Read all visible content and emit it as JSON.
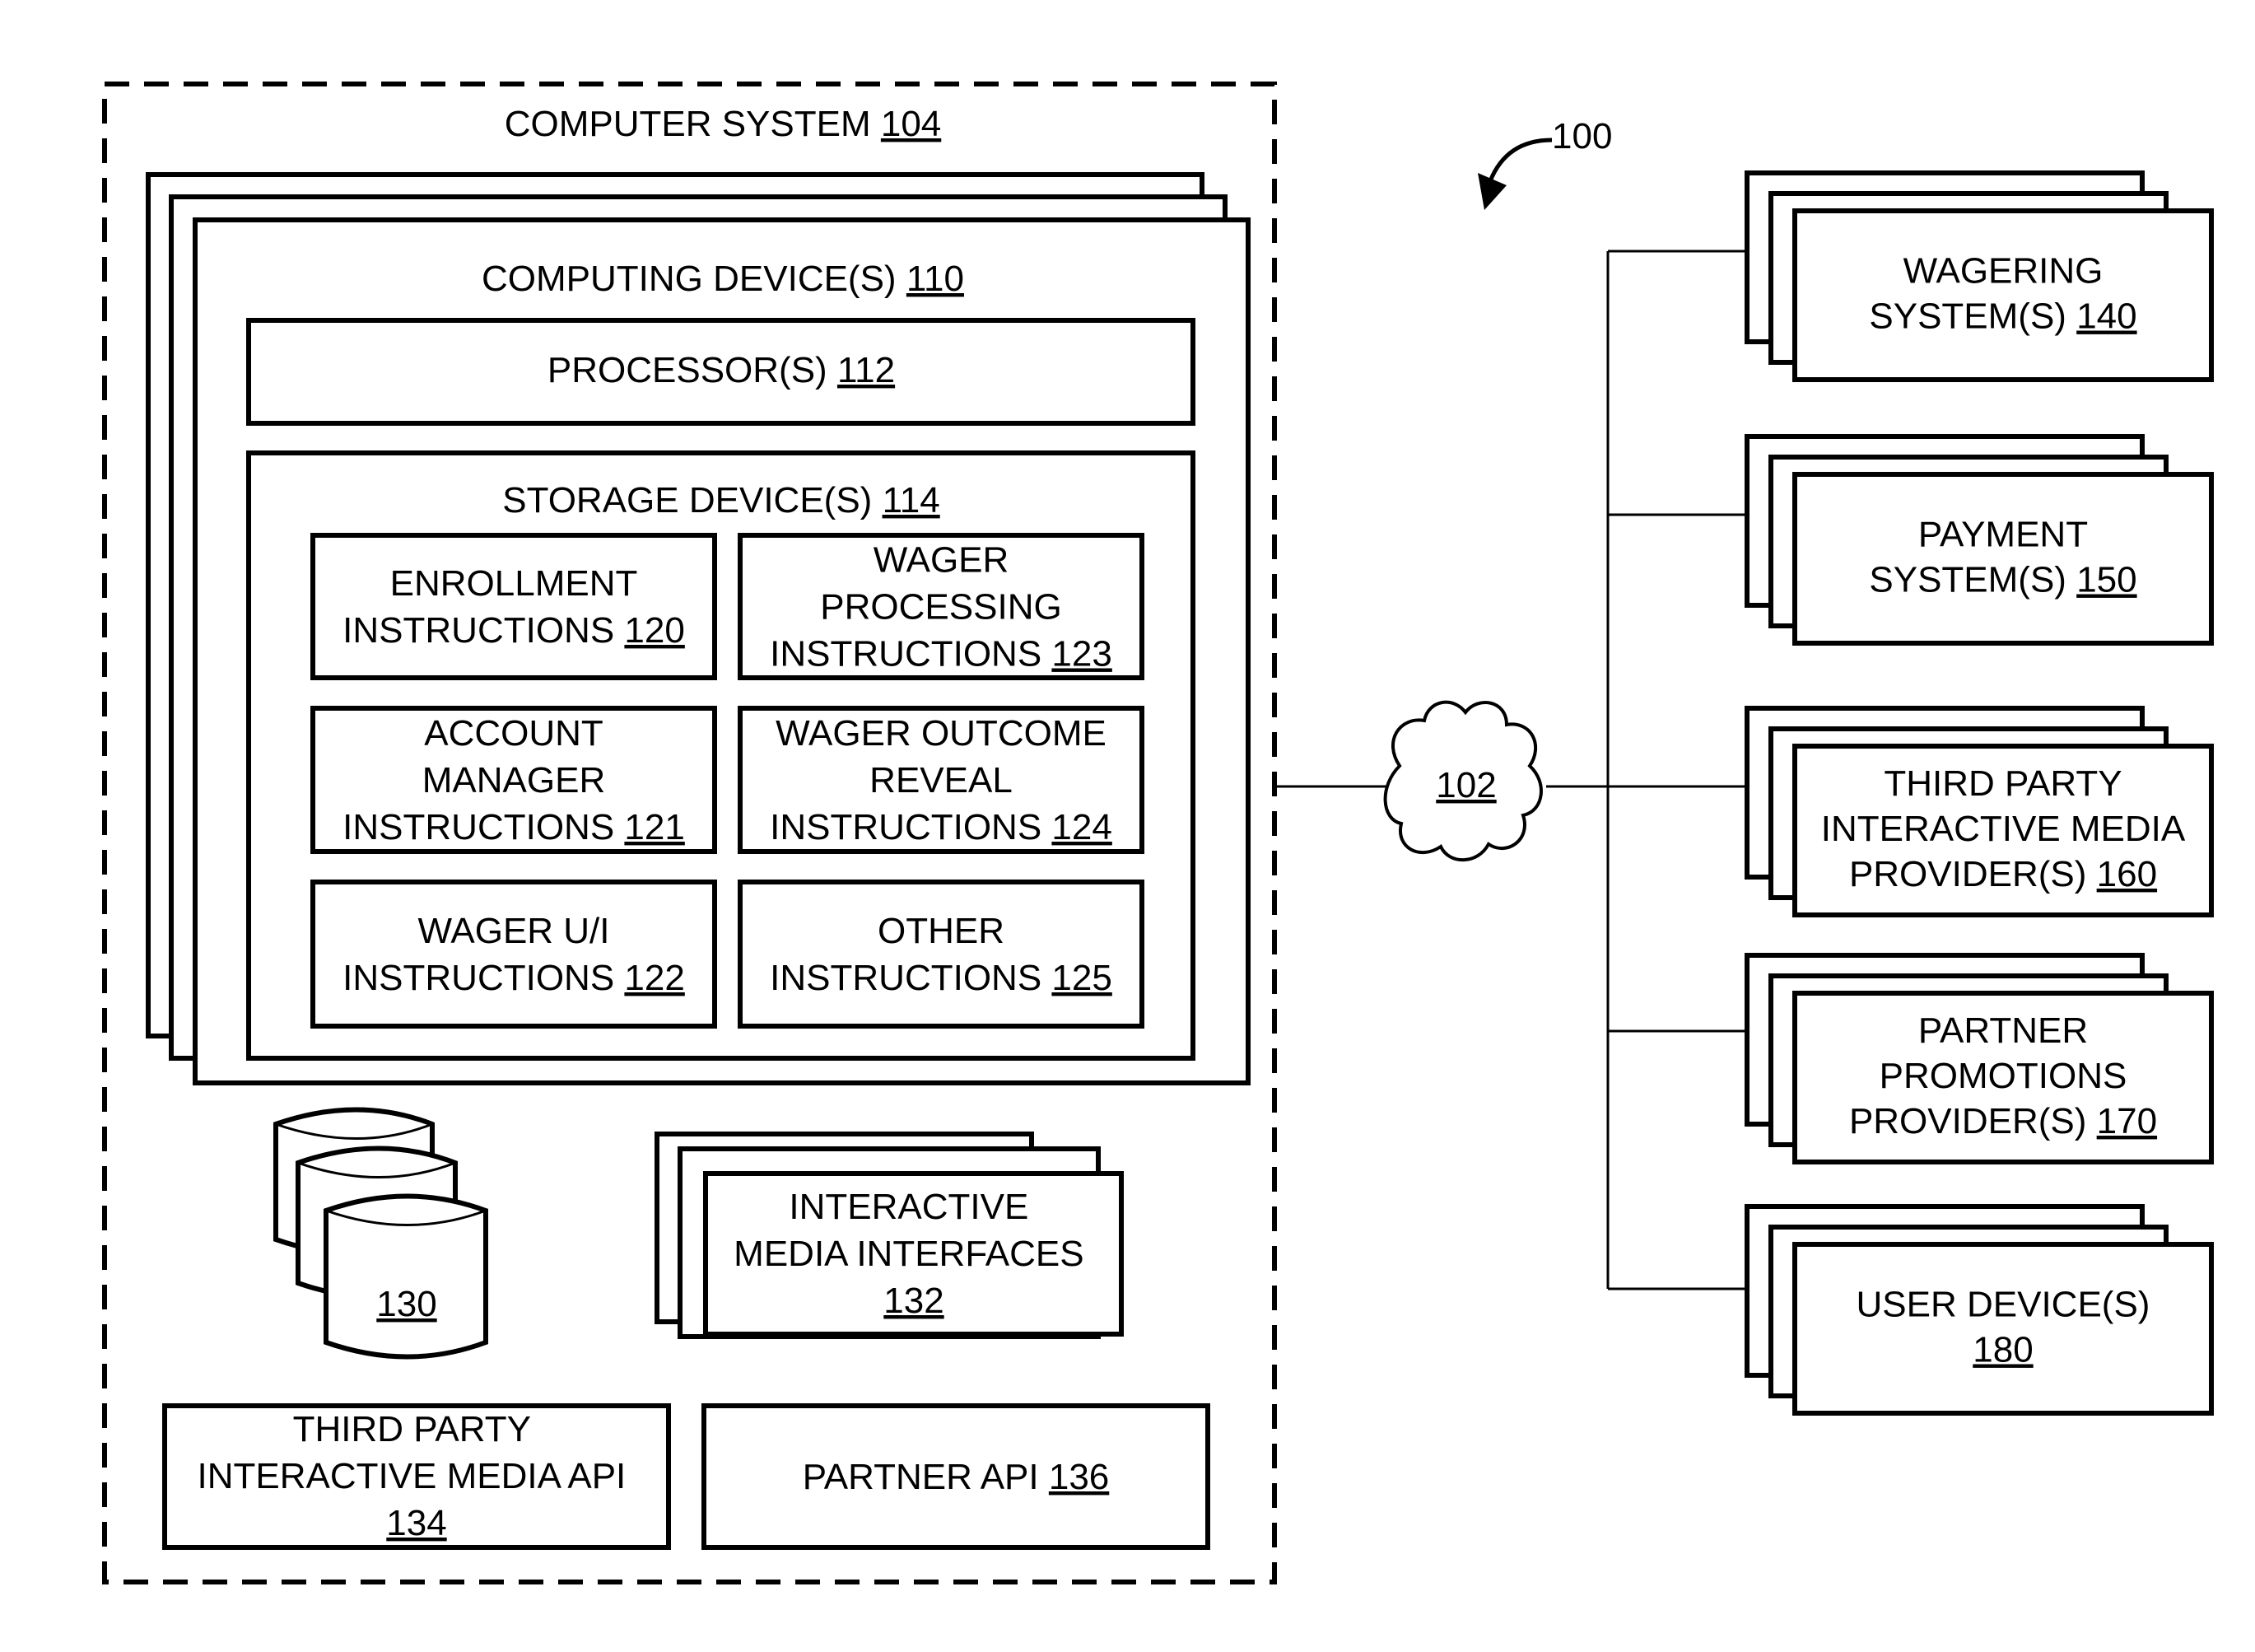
{
  "figure_ref": "100",
  "network": {
    "ref": "102"
  },
  "computer_system": {
    "title": "COMPUTER SYSTEM",
    "ref": "104",
    "computing_devices": {
      "title": "COMPUTING DEVICE(S)",
      "ref": "110"
    },
    "processor": {
      "title": "PROCESSOR(S)",
      "ref": "112"
    },
    "storage": {
      "title": "STORAGE DEVICE(S)",
      "ref": "114",
      "instructions": [
        {
          "lines": [
            "ENROLLMENT",
            "INSTRUCTIONS"
          ],
          "ref": "120"
        },
        {
          "lines": [
            "WAGER",
            "PROCESSING",
            "INSTRUCTIONS"
          ],
          "ref": "123"
        },
        {
          "lines": [
            "ACCOUNT",
            "MANAGER",
            "INSTRUCTIONS"
          ],
          "ref": "121"
        },
        {
          "lines": [
            "WAGER OUTCOME",
            "REVEAL",
            "INSTRUCTIONS"
          ],
          "ref": "124"
        },
        {
          "lines": [
            "WAGER U/I",
            "INSTRUCTIONS"
          ],
          "ref": "122"
        },
        {
          "lines": [
            "OTHER",
            "INSTRUCTIONS"
          ],
          "ref": "125"
        }
      ]
    },
    "database": {
      "ref": "130"
    },
    "interactive_media_interfaces": {
      "lines": [
        "INTERACTIVE",
        "MEDIA INTERFACES"
      ],
      "ref": "132"
    },
    "third_party_api": {
      "lines": [
        "THIRD PARTY",
        "INTERACTIVE MEDIA API"
      ],
      "ref": "134"
    },
    "partner_api": {
      "title": "PARTNER API",
      "ref": "136"
    }
  },
  "external_systems": [
    {
      "lines": [
        "WAGERING",
        "SYSTEM(S)"
      ],
      "ref": "140"
    },
    {
      "lines": [
        "PAYMENT",
        "SYSTEM(S)"
      ],
      "ref": "150"
    },
    {
      "lines": [
        "THIRD PARTY",
        "INTERACTIVE MEDIA",
        "PROVIDER(S)"
      ],
      "ref": "160"
    },
    {
      "lines": [
        "PARTNER",
        "PROMOTIONS",
        "PROVIDER(S)"
      ],
      "ref": "170"
    },
    {
      "lines": [
        "USER DEVICE(S)"
      ],
      "ref": "180",
      "ref_on_new_line": true
    }
  ]
}
